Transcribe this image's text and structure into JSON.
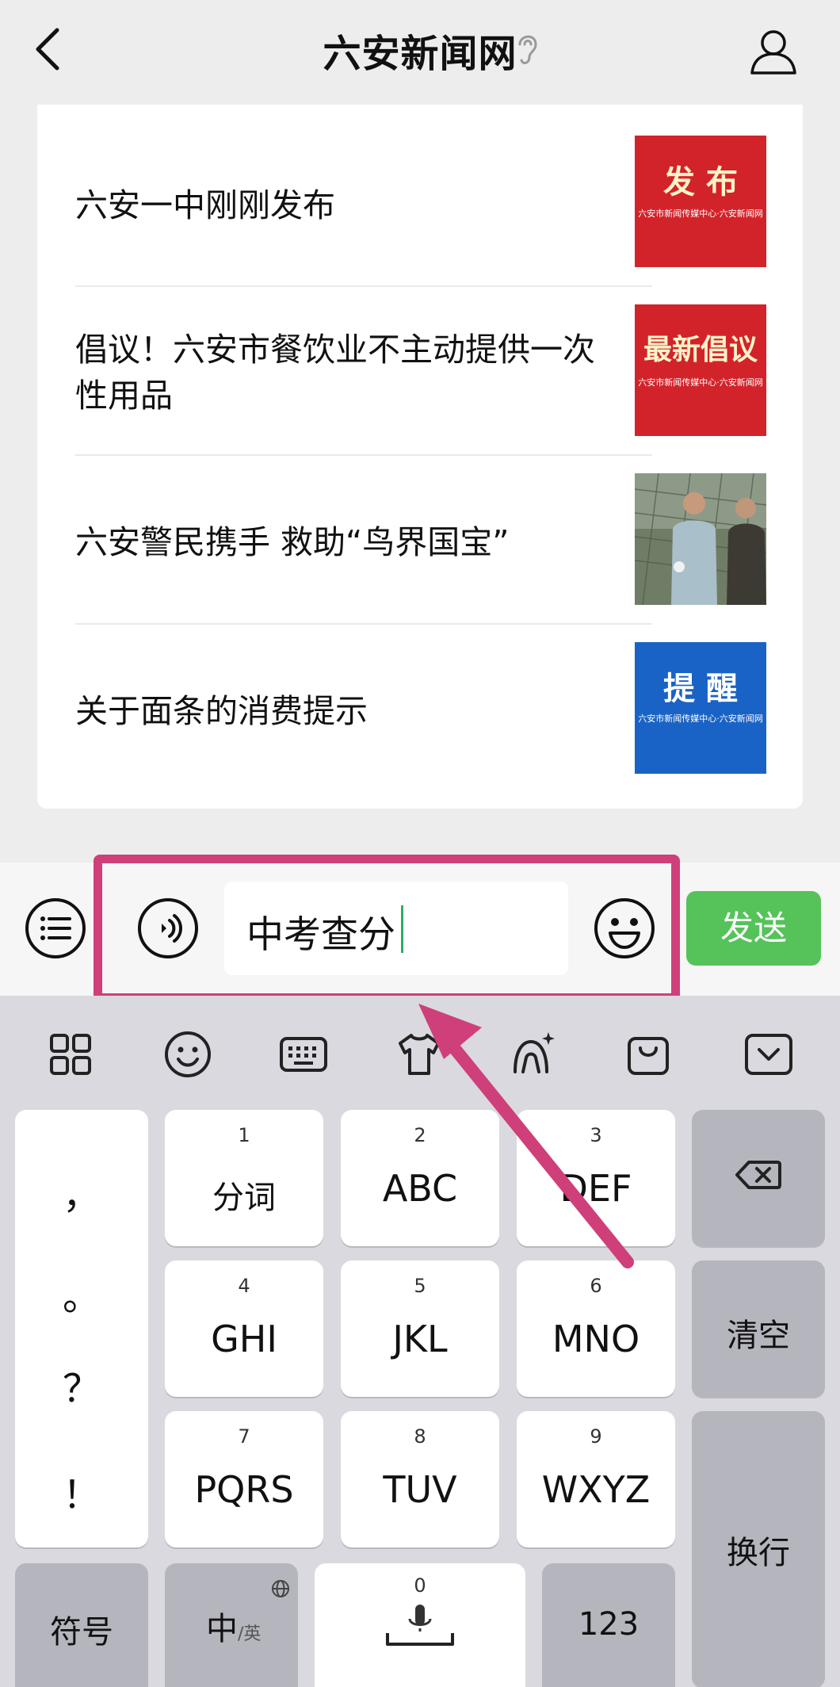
{
  "header": {
    "title": "六安新闻网",
    "back_icon": "chevron-left-icon",
    "ear_icon": "ear-icon",
    "profile_icon": "person-icon"
  },
  "articles": [
    {
      "title": "六安一中刚刚发布",
      "thumb_big": "发 布",
      "thumb_small": "六安市新闻传媒中心·六安新闻网",
      "thumb_color": "#d3232a"
    },
    {
      "title": "倡议！六安市餐饮业不主动提供一次性用品",
      "thumb_big": "最新倡议",
      "thumb_small": "六安市新闻传媒中心·六安新闻网",
      "thumb_color": "#d3232a"
    },
    {
      "title": "六安警民携手 救助“鸟界国宝”",
      "thumb_big": "",
      "thumb_small": "",
      "thumb_color": "#6c7b62"
    },
    {
      "title": "关于面条的消费提示",
      "thumb_big": "提 醒",
      "thumb_small": "六安市新闻传媒中心·六安新闻网",
      "thumb_color": "#1a63c6"
    }
  ],
  "input": {
    "value": "中考查分",
    "send_label": "发送",
    "highlight_color": "#cf3f79",
    "send_color": "#55c35a"
  },
  "keyboard": {
    "toolbar_icons": [
      "grid-icon",
      "smiley-icon",
      "keyboard-icon",
      "tshirt-icon",
      "ai-assistant-icon",
      "bag-icon",
      "collapse-icon"
    ],
    "punctuation": [
      "，",
      "。",
      "？",
      "！"
    ],
    "keys": [
      {
        "num": "1",
        "label": "分词"
      },
      {
        "num": "2",
        "label": "ABC"
      },
      {
        "num": "3",
        "label": "DEF"
      },
      {
        "num": "4",
        "label": "GHI"
      },
      {
        "num": "5",
        "label": "JKL"
      },
      {
        "num": "6",
        "label": "MNO"
      },
      {
        "num": "7",
        "label": "PQRS"
      },
      {
        "num": "8",
        "label": "TUV"
      },
      {
        "num": "9",
        "label": "WXYZ"
      }
    ],
    "clear_label": "清空",
    "newline_label": "换行",
    "symbol_label": "符号",
    "lang_main": "中",
    "lang_sub": "/英",
    "space_num": "0",
    "num_label": "123"
  }
}
